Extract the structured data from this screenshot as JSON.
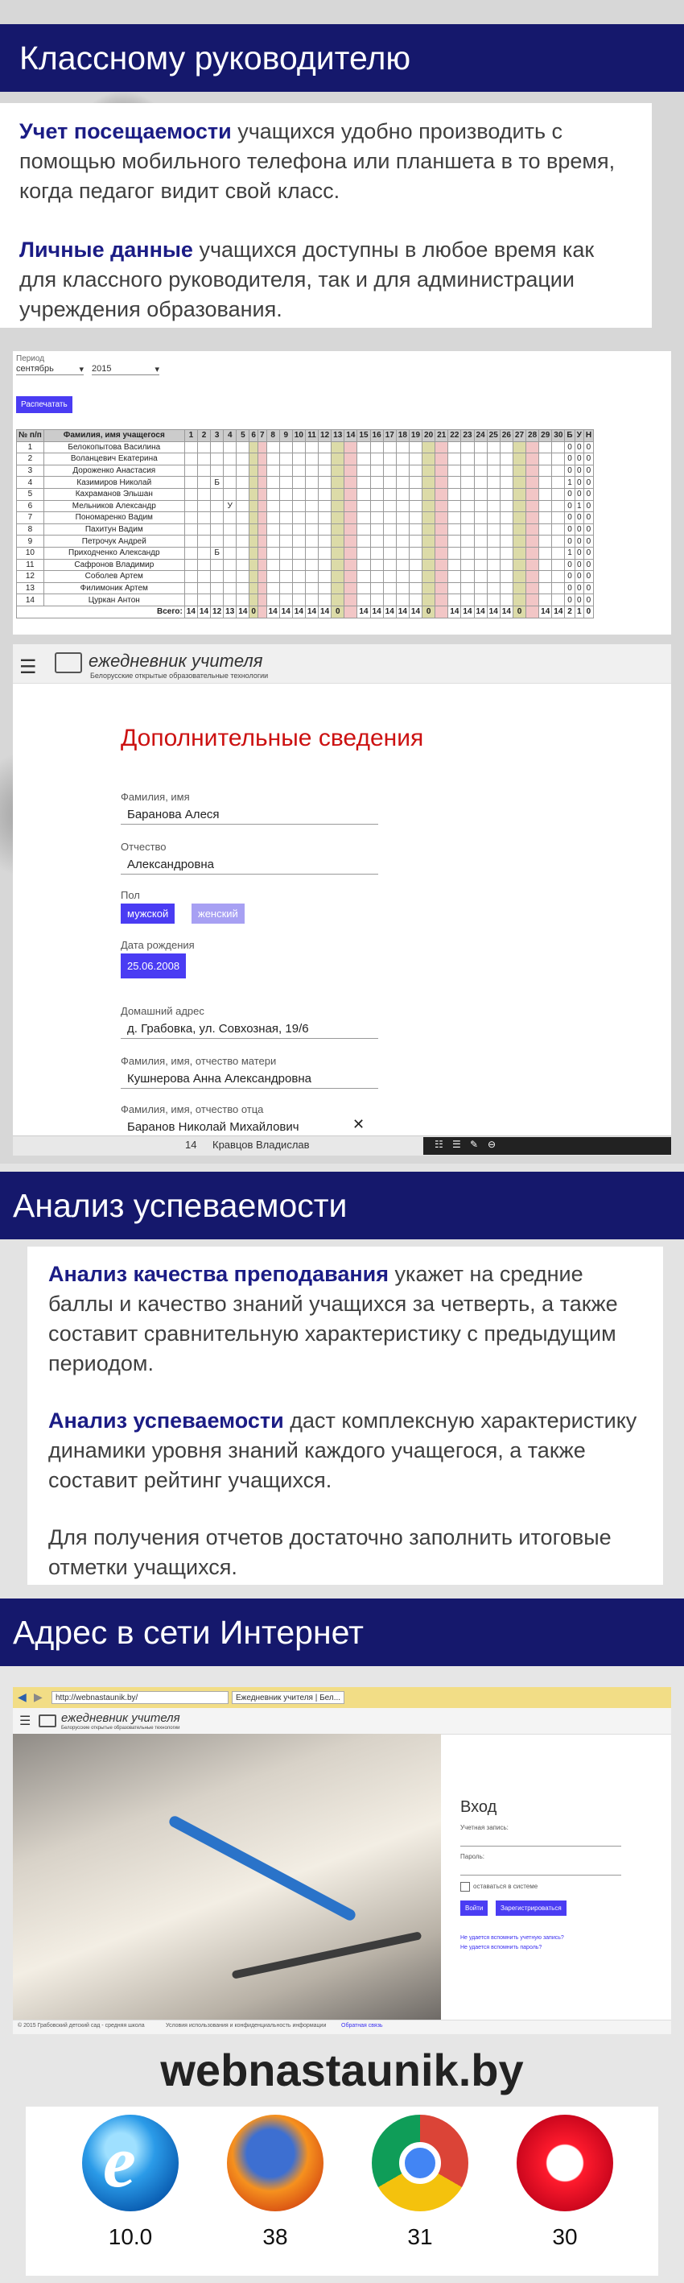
{
  "section1": {
    "title": "Классному руководителю",
    "p1_hl": "Учет посещаемости",
    "p1_rest": " учащихся удобно производить с помощью мобильного телефона или планшета в то время, когда педагог видит свой класс.",
    "p2_hl": "Личные данные",
    "p2_rest": " учащихся доступны в любое время как для классного руководителя, так и для администрации учреждения образования."
  },
  "attendance": {
    "period_label": "Период",
    "month": "сентябрь",
    "year": "2015",
    "print_button": "Распечатать",
    "col_num": "№ п/п",
    "col_name": "Фамилия, имя учащегося",
    "days": [
      "1",
      "2",
      "3",
      "4",
      "5",
      "6",
      "7",
      "8",
      "9",
      "10",
      "11",
      "12",
      "13",
      "14",
      "15",
      "16",
      "17",
      "18",
      "19",
      "20",
      "21",
      "22",
      "23",
      "24",
      "25",
      "26",
      "27",
      "28",
      "29",
      "30"
    ],
    "sum_cols": [
      "Б",
      "У",
      "Н"
    ],
    "students": [
      {
        "n": "1",
        "name": "Белокопытова Василина",
        "marks": {},
        "sums": [
          "0",
          "0",
          "0"
        ]
      },
      {
        "n": "2",
        "name": "Воланцевич Екатерина",
        "marks": {},
        "sums": [
          "0",
          "0",
          "0"
        ]
      },
      {
        "n": "3",
        "name": "Дороженко Анастасия",
        "marks": {},
        "sums": [
          "0",
          "0",
          "0"
        ]
      },
      {
        "n": "4",
        "name": "Казимиров Николай",
        "marks": {
          "2": "Б"
        },
        "sums": [
          "1",
          "0",
          "0"
        ]
      },
      {
        "n": "5",
        "name": "Кахраманов Эльшан",
        "marks": {},
        "sums": [
          "0",
          "0",
          "0"
        ]
      },
      {
        "n": "6",
        "name": "Мельников Александр",
        "marks": {
          "3": "У"
        },
        "sums": [
          "0",
          "1",
          "0"
        ]
      },
      {
        "n": "7",
        "name": "Пономаренко Вадим",
        "marks": {},
        "sums": [
          "0",
          "0",
          "0"
        ]
      },
      {
        "n": "8",
        "name": "Пахитун Вадим",
        "marks": {},
        "sums": [
          "0",
          "0",
          "0"
        ]
      },
      {
        "n": "9",
        "name": "Петрочук Андрей",
        "marks": {},
        "sums": [
          "0",
          "0",
          "0"
        ]
      },
      {
        "n": "10",
        "name": "Приходченко Александр",
        "marks": {
          "2": "Б"
        },
        "sums": [
          "1",
          "0",
          "0"
        ]
      },
      {
        "n": "11",
        "name": "Сафронов Владимир",
        "marks": {},
        "sums": [
          "0",
          "0",
          "0"
        ]
      },
      {
        "n": "12",
        "name": "Соболев Артем",
        "marks": {},
        "sums": [
          "0",
          "0",
          "0"
        ]
      },
      {
        "n": "13",
        "name": "Филимоник Артем",
        "marks": {},
        "sums": [
          "0",
          "0",
          "0"
        ]
      },
      {
        "n": "14",
        "name": "Цуркан Антон",
        "marks": {},
        "sums": [
          "0",
          "0",
          "0"
        ]
      }
    ],
    "total_label": "Всего:",
    "totals": [
      "14",
      "14",
      "12",
      "13",
      "14",
      "0",
      "",
      "14",
      "14",
      "14",
      "14",
      "14",
      "0",
      "",
      "14",
      "14",
      "14",
      "14",
      "14",
      "0",
      "",
      "14",
      "14",
      "14",
      "14",
      "14",
      "0",
      "",
      "14",
      "14"
    ],
    "total_sums": [
      "2",
      "1",
      "0"
    ]
  },
  "form": {
    "logo_title": "ежедневник учителя",
    "logo_sub": "Белорусские открытые образовательные технологии",
    "heading": "Дополнительные сведения",
    "surname_label": "Фамилия, имя",
    "surname_value": "Баранова Алеся",
    "patronymic_label": "Отчество",
    "patronymic_value": "Александровна",
    "gender_label": "Пол",
    "gender_male": "мужской",
    "gender_female": "женский",
    "birth_label": "Дата рождения",
    "birth_value": "25.06.2008",
    "address_label": "Домашний адрес",
    "address_value": "д. Грабовка, ул. Совхозная, 19/6",
    "mother_label": "Фамилия, имя, отчество матери",
    "mother_value": "Кушнерова Анна Александровна",
    "father_label": "Фамилия, имя, отчество отца",
    "father_value": "Баранов Николай Михайлович",
    "under_num": "14",
    "under_name": "Кравцов Владислав"
  },
  "section2": {
    "title": "Анализ успеваемости",
    "p1_hl": "Анализ качества преподавания",
    "p1_rest": " укажет на средние баллы и качество знаний учащихся за четверть, а также составит сравнительную характеристику с предыдущим периодом.",
    "p2_hl": "Анализ успеваемости",
    "p2_rest": " даст комплексную характеристику динамики уровня знаний каждого учащегося, а также  составит рейтинг учащихся.",
    "p3": "Для получения отчетов достаточно заполнить итоговые отметки учащихся."
  },
  "section3": {
    "title": "Адрес в сети Интернет",
    "url": "http://webnastaunik.by/",
    "tab_title": "Ежедневник учителя | Бел...",
    "logo_title": "ежедневник учителя",
    "logo_sub": "Белорусские открытые образовательные технологии",
    "login_heading": "Вход",
    "account_label": "Учетная запись:",
    "password_label": "Пароль:",
    "remember_label": "оставаться в системе",
    "login_button": "Войти",
    "register_button": "Зарегистрироваться",
    "forgot_account": "Не удается вспомнить учетную запись?",
    "forgot_password": "Не удается вспомнить пароль?",
    "footer_copyright": "© 2015 Грабовский детский сад - средняя школа",
    "footer_terms": "Условия использования и конфиденциальность информации",
    "footer_feedback": "Обратная связь",
    "site_address": "webnastaunik.by"
  },
  "browsers": [
    {
      "name": "internet-explorer",
      "version": "10.0"
    },
    {
      "name": "firefox",
      "version": "38"
    },
    {
      "name": "chrome",
      "version": "31"
    },
    {
      "name": "opera",
      "version": "30"
    }
  ],
  "colors": {
    "banner": "#15186c",
    "highlight": "#1b1c85",
    "button": "#4a3cf3",
    "form_heading": "#cc1111"
  }
}
